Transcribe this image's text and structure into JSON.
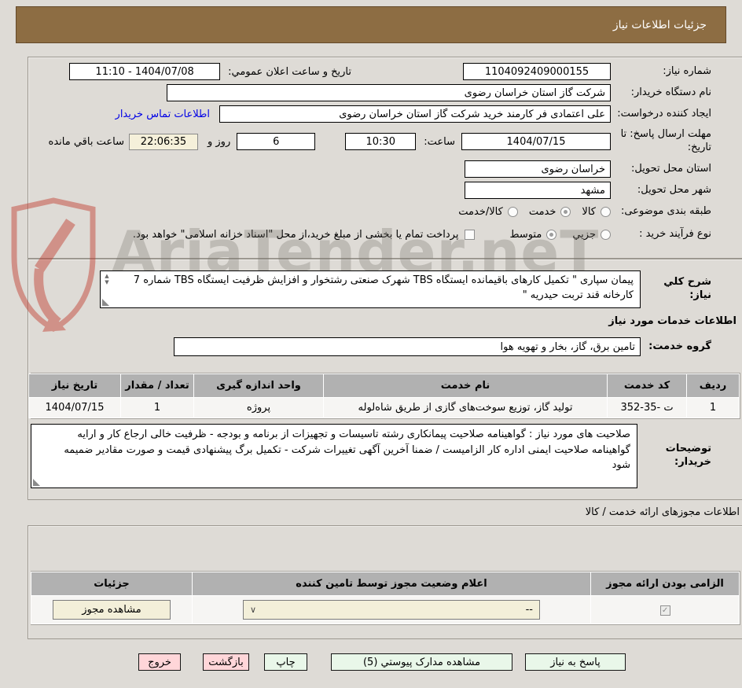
{
  "title_bar": {
    "title": "جزئیات اطلاعات نیاز"
  },
  "general": {
    "need_number_label": "شماره نیاز:",
    "need_number": "1104092409000155",
    "announce_datetime_label": "تاریخ و ساعت اعلان عمومي:",
    "announce_datetime": "1404/07/08 - 11:10",
    "buyer_org_label": "نام دستگاه خریدار:",
    "buyer_org": "شرکت گاز استان خراسان رضوی",
    "request_creator_label": "ایجاد کننده درخواست:",
    "request_creator": "علی اعتمادی فر کارمند خرید شرکت گاز استان خراسان رضوی",
    "buyer_contact_link": "اطلاعات تماس خریدار",
    "reply_deadline_label": "مهلت ارسال پاسخ: تا تاریخ:",
    "reply_deadline_date": "1404/07/15",
    "hour_label": "ساعت:",
    "reply_deadline_time": "10:30",
    "days_remaining": "6",
    "days_and_label": "روز و",
    "time_remaining": "22:06:35",
    "time_remaining_label": "ساعت باقي مانده",
    "delivery_province_label": "استان محل تحویل:",
    "delivery_province": "خراسان رضوی",
    "delivery_city_label": "شهر محل تحویل:",
    "delivery_city": "مشهد",
    "subject_class_label": "طبقه بندی موضوعی:",
    "subject_options": [
      "کالا",
      "خدمت",
      "کالا/خدمت"
    ],
    "subject_selected": "خدمت",
    "process_type_label": "نوع فرآیند خرید :",
    "process_options": [
      "جزیي",
      "متوسط"
    ],
    "process_selected": "متوسط",
    "treasury_note": "پرداخت تمام یا بخشی از مبلغ خرید،از محل \"اسناد خزانه اسلامی\" خواهد بود."
  },
  "services": {
    "need_desc_label": "شرح کلي نیاز:",
    "need_desc": "پیمان سپاری \" تکمیل کارهای باقیمانده ایستگاه TBS شهرک صنعتی رشتخوار  و افزایش ظرفیت ایستگاه TBS شماره 7 کارخانه قند تربت حیدریه \"",
    "section_heading": "اطلاعات خدمات مورد نیاز",
    "service_group_label": "گروه خدمت:",
    "service_group": "تامین برق، گاز، بخار و تهویه هوا",
    "table": {
      "headers": [
        "ردیف",
        "کد خدمت",
        "نام خدمت",
        "واحد اندازه گیری",
        "تعداد / مقدار",
        "تاریخ نیاز"
      ],
      "rows": [
        {
          "index": "1",
          "code": "352-35- ت",
          "name": "تولید گاز، توزیع سوخت‌های گازی از طریق شاه‌لوله",
          "unit": "پروژه",
          "quantity": "1",
          "need_date": "1404/07/15"
        }
      ]
    },
    "buyer_notes_label": "توضیحات خریدار:",
    "buyer_notes": "صلاحیت های مورد نیاز : گواهینامه صلاحیت پیمانکاری رشته تاسیسات و تجهیزات از  برنامه و بودجه - ظرفیت خالی ارجاع کار  و ارایه گواهینامه صلاحیت ایمنی  اداره کار الزامیست / ضمنا آخرین آگهی تغییرات شرکت - تکمیل برگ پیشنهادی قیمت و صورت مقادیر ضمیمه شود"
  },
  "licenses": {
    "section_heading": "اطلاعات مجوزهای ارائه خدمت / کالا",
    "table": {
      "headers": [
        "الزامی بودن ارائه مجوز",
        "اعلام وضعیت مجوز توسط تامین کننده",
        "جزئیات"
      ],
      "row": {
        "required_checked": true,
        "status_value": "--",
        "details_button": "مشاهده مجوز"
      }
    }
  },
  "footer_buttons": [
    {
      "label": "پاسخ به نیاز",
      "style": "mint"
    },
    {
      "label": "مشاهده مدارک پیوستي (5)",
      "style": "mint"
    },
    {
      "label": "چاپ",
      "style": "mint"
    },
    {
      "label": "بازگشت",
      "style": "pink"
    },
    {
      "label": "خروج",
      "style": "pink"
    }
  ],
  "watermark": {
    "text": "AriaTender.neT",
    "shield_color": "#c0392b",
    "text_color": "#77736b"
  },
  "colors": {
    "titlebar": "#8d6d43",
    "page_bg": "#dedbd6",
    "highlight_box": "#f5f0da",
    "table_header": "#b1b1b1",
    "button_mint": "#e9f7e9",
    "button_pink": "#ffd6d9",
    "cream_control": "#f3efd9",
    "link_blue": "#0000e6"
  }
}
